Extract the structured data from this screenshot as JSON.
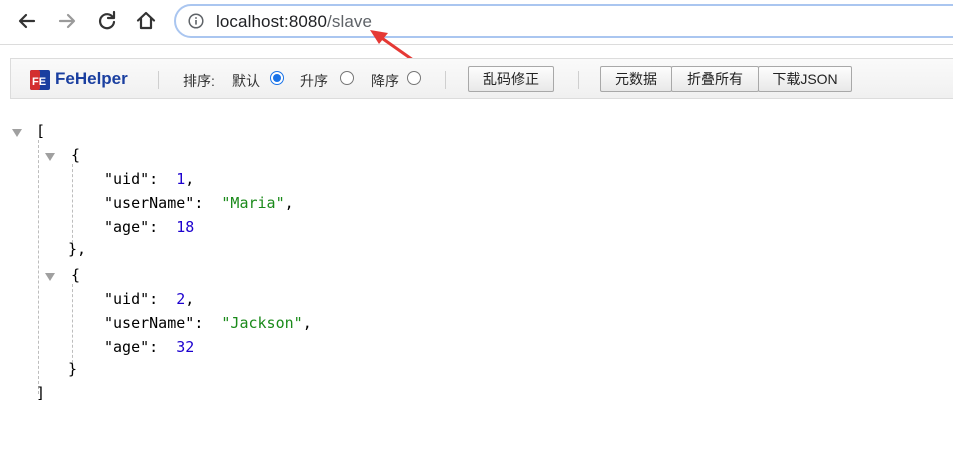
{
  "browser": {
    "url_host": "localhost:8080",
    "url_path": "/slave"
  },
  "fehelper": {
    "brand": "FeHelper",
    "sort_label": "排序:",
    "sort_default": "默认",
    "sort_asc": "升序",
    "sort_desc": "降序",
    "fix_encoding": "乱码修正",
    "metadata": "元数据",
    "collapse_all": "折叠所有",
    "download_json": "下载JSON",
    "selected_sort": "默认"
  },
  "json_view": {
    "open_bracket": "[",
    "close_bracket": "]",
    "objects": [
      {
        "open": "{",
        "close": "},",
        "fields": [
          {
            "key": "\"uid\"",
            "value": "1",
            "type": "num",
            "trail": ","
          },
          {
            "key": "\"userName\"",
            "value": "\"Maria\"",
            "type": "str",
            "trail": ","
          },
          {
            "key": "\"age\"",
            "value": "18",
            "type": "num",
            "trail": ""
          }
        ]
      },
      {
        "open": "{",
        "close": "}",
        "fields": [
          {
            "key": "\"uid\"",
            "value": "2",
            "type": "num",
            "trail": ","
          },
          {
            "key": "\"userName\"",
            "value": "\"Jackson\"",
            "type": "str",
            "trail": ","
          },
          {
            "key": "\"age\"",
            "value": "32",
            "type": "num",
            "trail": ""
          }
        ]
      }
    ]
  },
  "colors": {
    "arrow": "#e53935",
    "radio_selected": "#1a73e8",
    "brand": "#1a3fa0"
  }
}
